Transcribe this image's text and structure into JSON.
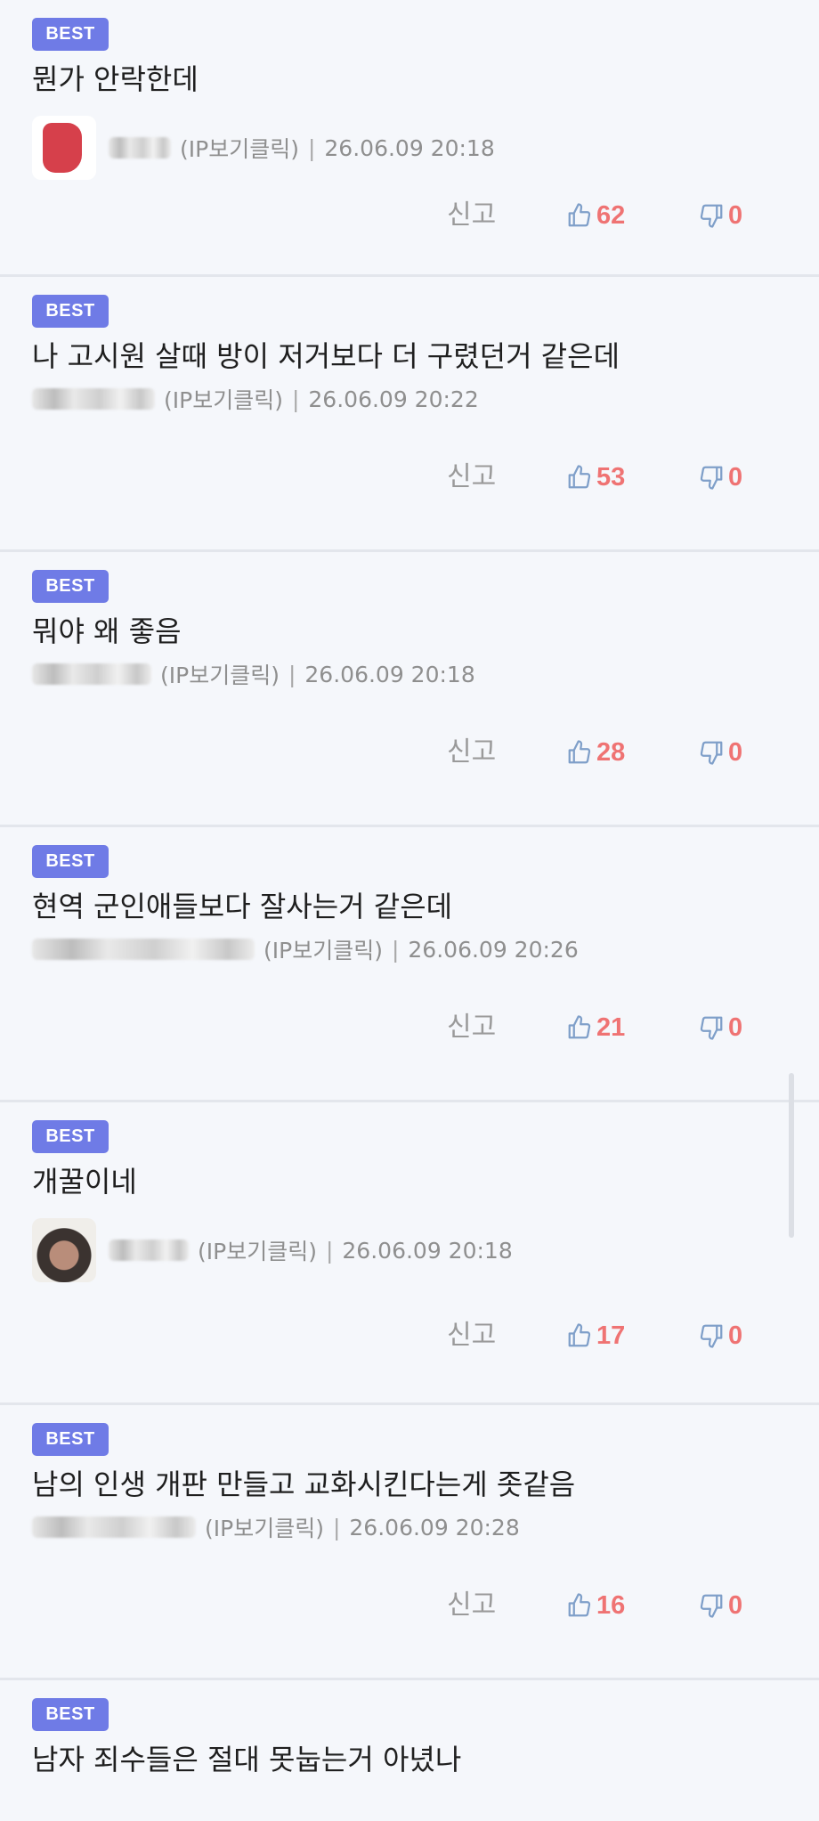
{
  "badge_label": "BEST",
  "report_label": "신고",
  "ip_label": "(IP보기클릭)",
  "separator": "|",
  "comments": [
    {
      "text": "뭔가 안락한데",
      "date": "26.06.09 20:18",
      "likes": "62",
      "dislikes": "0"
    },
    {
      "text": "나 고시원 살때 방이 저거보다 더 구렸던거 같은데",
      "date": "26.06.09 20:22",
      "likes": "53",
      "dislikes": "0"
    },
    {
      "text": "뭐야 왜 좋음",
      "date": "26.06.09 20:18",
      "likes": "28",
      "dislikes": "0"
    },
    {
      "text": "현역 군인애들보다 잘사는거 같은데",
      "date": "26.06.09 20:26",
      "likes": "21",
      "dislikes": "0"
    },
    {
      "text": "개꿀이네",
      "date": "26.06.09 20:18",
      "likes": "17",
      "dislikes": "0"
    },
    {
      "text": "남의 인생 개판 만들고 교화시킨다는게 좃같음",
      "date": "26.06.09 20:28",
      "likes": "16",
      "dislikes": "0"
    },
    {
      "text": "남자 죄수들은 절대 못눕는거 아녔나"
    }
  ],
  "icons": {
    "like": "thumbs-up-icon",
    "dislike": "thumbs-down-icon"
  },
  "colors": {
    "badge": "#6f7be6",
    "count": "#ef7373",
    "icon": "#7f9fc9"
  }
}
